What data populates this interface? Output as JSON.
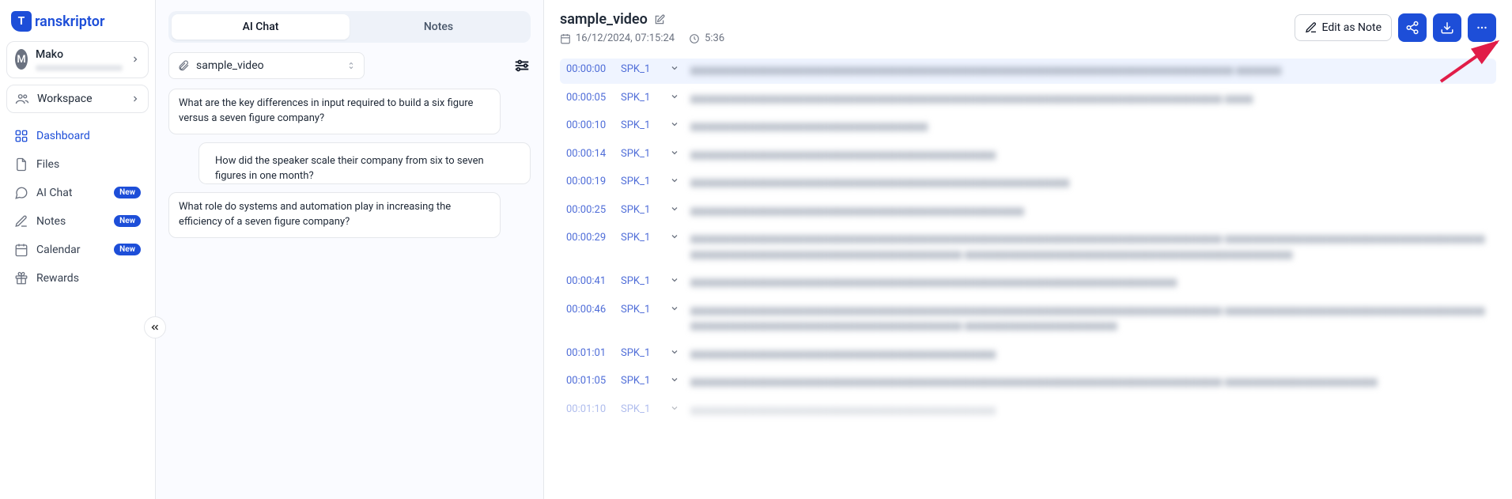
{
  "brand": {
    "short": "T",
    "name": "ranskriptor"
  },
  "user": {
    "initial": "M",
    "name": "Mako"
  },
  "sidebar": {
    "workspace_label": "Workspace",
    "items": [
      {
        "label": "Dashboard",
        "icon": "dashboard",
        "active": true,
        "new": false
      },
      {
        "label": "Files",
        "icon": "files",
        "active": false,
        "new": false
      },
      {
        "label": "AI Chat",
        "icon": "chat",
        "active": false,
        "new": true
      },
      {
        "label": "Notes",
        "icon": "notes",
        "active": false,
        "new": true
      },
      {
        "label": "Calendar",
        "icon": "calendar",
        "active": false,
        "new": true
      },
      {
        "label": "Rewards",
        "icon": "rewards",
        "active": false,
        "new": false
      }
    ],
    "new_badge": "New"
  },
  "center": {
    "tabs": {
      "chat": "AI Chat",
      "notes": "Notes"
    },
    "source": "sample_video",
    "chat": [
      {
        "side": "left",
        "text": "What are the key differences in input required to build a six figure versus a seven figure company?"
      },
      {
        "side": "right",
        "text": "How did the speaker scale their company from six to seven figures in one month?"
      },
      {
        "side": "left",
        "text": "What role do systems and automation play in increasing the efficiency of a seven figure company?"
      }
    ]
  },
  "right_panel": {
    "title": "sample_video",
    "date": "16/12/2024, 07:15:24",
    "duration": "5:36",
    "edit_as_note": "Edit as Note",
    "transcript": [
      {
        "ts": "00:00:00",
        "spk": "SPK_1",
        "blur": "▮▮▮▮▮▮▮▮▮▮▮▮▮▮▮▮▮▮▮▮▮▮▮▮▮▮▮▮▮▮▮▮▮▮▮▮▮▮▮▮▮▮▮▮▮▮▮▮▮▮▮▮▮▮▮▮▮▮▮▮▮▮▮▮▮▮▮▮▮▮▮▮▮▮▮▮▮▮▮▮▮▮▮▮▮▮▮▮▮▮▮▮▮▮▮▮ ▮▮▮▮▮▮▮▮",
        "active": true
      },
      {
        "ts": "00:00:05",
        "spk": "SPK_1",
        "blur": "▮▮▮▮▮▮▮▮▮▮▮▮▮▮▮▮▮▮▮▮▮▮▮▮▮▮▮▮▮▮▮▮▮▮▮▮▮▮▮▮▮▮▮▮▮▮▮▮▮▮▮▮▮▮▮▮▮▮▮▮▮▮▮▮▮▮▮▮▮▮▮▮▮▮▮▮▮▮▮▮▮▮▮▮▮▮▮▮▮▮▮▮▮▮ ▮▮▮▮▮"
      },
      {
        "ts": "00:00:10",
        "spk": "SPK_1",
        "blur": "▮▮▮▮▮▮▮▮▮▮▮▮▮▮▮▮▮▮▮▮▮▮▮▮▮▮▮▮▮▮▮▮▮▮▮▮▮▮▮▮▮▮"
      },
      {
        "ts": "00:00:14",
        "spk": "SPK_1",
        "blur": "▮▮▮▮▮▮▮▮▮▮▮▮▮▮▮▮▮▮▮▮▮▮▮▮▮▮▮▮▮▮▮▮▮▮▮▮▮▮▮▮▮▮▮▮▮▮▮▮▮▮▮▮▮▮"
      },
      {
        "ts": "00:00:19",
        "spk": "SPK_1",
        "blur": "▮▮▮▮▮▮▮▮▮▮▮▮▮▮▮▮▮▮▮▮▮▮▮▮▮▮▮▮▮▮▮▮▮▮▮▮▮▮▮▮▮▮▮▮▮▮▮▮▮▮▮▮▮▮▮▮▮▮▮▮▮▮▮▮▮▮▮"
      },
      {
        "ts": "00:00:25",
        "spk": "SPK_1",
        "blur": "▮▮▮▮▮▮▮▮▮▮▮▮▮▮▮▮▮▮▮▮▮▮▮▮▮▮▮▮▮▮▮▮▮▮▮▮▮▮▮▮▮▮▮▮▮▮▮▮▮▮▮▮▮▮▮▮▮▮▮"
      },
      {
        "ts": "00:00:29",
        "spk": "SPK_1",
        "blur": "▮▮▮▮▮▮▮▮▮▮▮▮▮▮▮▮▮▮▮▮▮▮▮▮▮▮▮▮▮▮▮▮▮▮▮▮▮▮▮▮▮▮▮▮▮▮▮▮▮▮▮▮▮▮▮▮▮▮▮▮▮▮▮▮▮▮▮▮▮▮▮▮▮▮▮▮▮▮▮▮▮▮▮▮▮▮▮▮▮▮▮▮▮▮ ▮▮▮▮▮▮▮▮▮▮▮▮▮▮▮▮▮▮▮▮▮▮▮▮▮▮▮▮▮▮▮▮▮▮▮▮▮▮▮▮▮▮▮▮▮▮▮▮▮▮▮▮▮▮▮▮▮▮▮▮▮▮▮▮▮▮▮▮▮▮▮▮▮▮▮▮▮▮▮▮▮▮▮▮▮▮▮▮▮▮▮▮▮▮ ▮▮▮▮▮▮▮▮▮▮▮▮▮▮▮▮▮▮▮▮▮▮▮▮▮▮▮▮▮▮▮▮▮▮▮▮▮▮▮▮▮▮▮▮▮▮▮▮▮▮▮▮▮▮▮▮▮▮"
      },
      {
        "ts": "00:00:41",
        "spk": "SPK_1",
        "blur": "▮▮▮▮▮▮▮▮▮▮▮▮▮▮▮▮▮▮▮▮▮▮▮▮▮▮▮▮▮▮▮▮▮▮▮▮▮▮▮▮▮▮▮▮▮▮▮▮▮▮▮▮▮▮▮▮▮▮▮▮▮▮▮▮▮▮▮▮▮▮▮▮▮▮▮▮▮▮▮▮▮▮▮▮▮▮"
      },
      {
        "ts": "00:00:46",
        "spk": "SPK_1",
        "blur": "▮▮▮▮▮▮▮▮▮▮▮▮▮▮▮▮▮▮▮▮▮▮▮▮▮▮▮▮▮▮▮▮▮▮▮▮▮▮▮▮▮▮▮▮▮▮▮▮▮▮▮▮▮▮▮▮▮▮▮▮▮▮▮▮▮▮▮▮▮▮▮▮▮▮▮▮▮▮▮▮▮▮▮▮▮▮▮▮▮▮▮▮▮▮ ▮▮▮▮▮▮▮▮▮▮▮▮▮▮▮▮▮▮▮▮▮▮▮▮▮▮▮▮▮▮▮▮▮▮▮▮▮▮▮▮▮▮▮▮▮▮▮▮▮▮▮▮▮▮▮▮▮▮▮▮▮▮▮▮▮▮▮▮▮▮▮▮▮▮▮▮▮▮▮▮▮▮▮▮▮▮▮▮▮▮▮▮▮▮ ▮▮▮▮▮▮▮▮▮▮▮▮▮▮▮▮▮▮▮▮▮▮▮▮▮▮▮"
      },
      {
        "ts": "00:01:01",
        "spk": "SPK_1",
        "blur": "▮▮▮▮▮▮▮▮▮▮▮▮▮▮▮▮▮▮▮▮▮▮▮▮▮▮▮▮▮▮▮▮▮▮▮▮▮▮▮▮▮▮▮▮▮▮▮▮▮▮▮▮▮▮"
      },
      {
        "ts": "00:01:05",
        "spk": "SPK_1",
        "blur": "▮▮▮▮▮▮▮▮▮▮▮▮▮▮▮▮▮▮▮▮▮▮▮▮▮▮▮▮▮▮▮▮▮▮▮▮▮▮▮▮▮▮▮▮▮▮▮▮▮▮▮▮▮▮▮▮▮▮▮▮▮▮▮▮▮▮▮▮▮▮▮▮▮▮▮▮▮▮▮▮▮▮▮▮▮▮▮▮▮▮▮▮▮▮ ▮▮▮▮▮▮▮▮▮▮▮▮▮▮▮▮▮▮▮▮▮▮▮▮▮▮▮"
      },
      {
        "ts": "00:01:10",
        "spk": "SPK_1",
        "blur": "▮▮▮▮▮▮▮▮▮▮▮▮▮▮▮▮▮▮▮▮▮▮▮▮▮▮▮▮▮▮▮▮▮▮▮▮▮▮▮▮▮▮▮▮▮▮▮▮▮▮▮▮▮▮",
        "faded": true
      }
    ]
  },
  "callout_arrow_color": "#e11d48"
}
